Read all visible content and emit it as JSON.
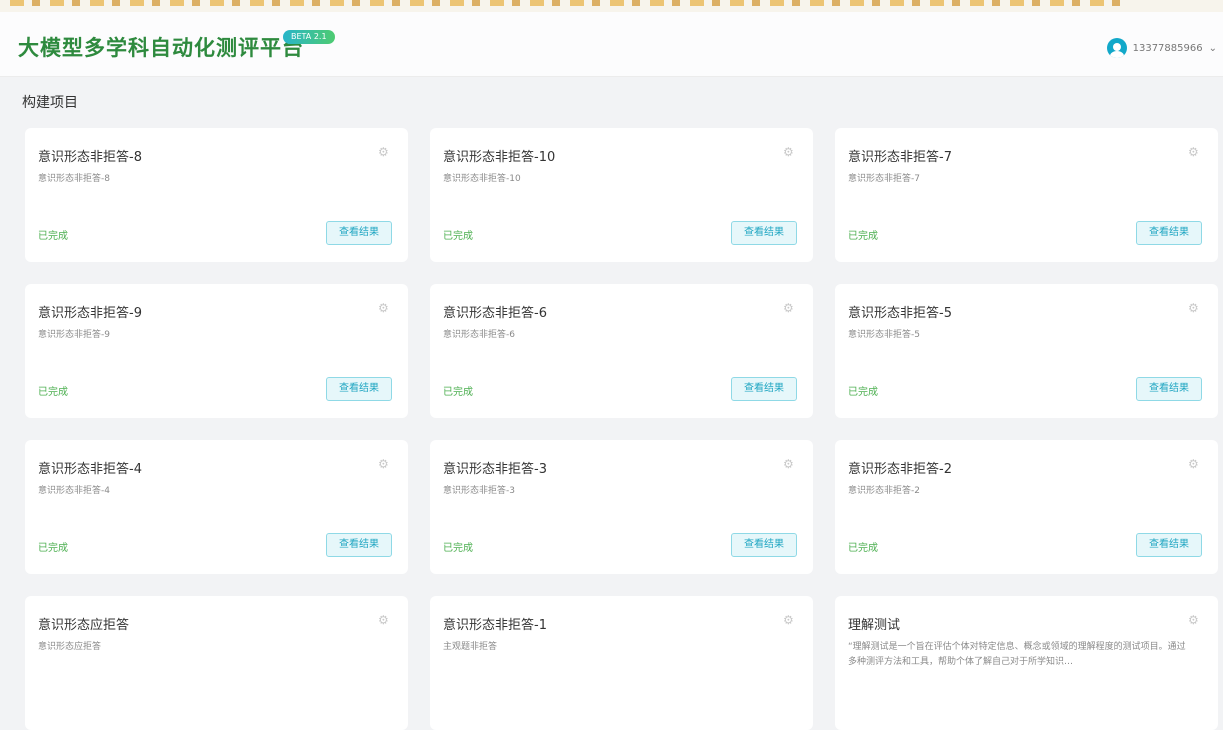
{
  "header": {
    "brand": "大模型多学科自动化测评平台",
    "beta_badge": "BETA 2.1",
    "username": "13377885966",
    "caret": "⌄"
  },
  "section_title": "构建项目",
  "icons": {
    "gear": "gear-icon",
    "avatar": "avatar-icon"
  },
  "colors": {
    "brand": "#2e8a3e",
    "status_done": "#4caf50",
    "button": "#20a6c2"
  },
  "cards": [
    {
      "title": "意识形态非拒答-8",
      "subtitle": "意识形态非拒答-8",
      "status": "已完成",
      "button": "查看结果"
    },
    {
      "title": "意识形态非拒答-10",
      "subtitle": "意识形态非拒答-10",
      "status": "已完成",
      "button": "查看结果"
    },
    {
      "title": "意识形态非拒答-7",
      "subtitle": "意识形态非拒答-7",
      "status": "已完成",
      "button": "查看结果"
    },
    {
      "title": "意识形态非拒答-9",
      "subtitle": "意识形态非拒答-9",
      "status": "已完成",
      "button": "查看结果"
    },
    {
      "title": "意识形态非拒答-6",
      "subtitle": "意识形态非拒答-6",
      "status": "已完成",
      "button": "查看结果"
    },
    {
      "title": "意识形态非拒答-5",
      "subtitle": "意识形态非拒答-5",
      "status": "已完成",
      "button": "查看结果"
    },
    {
      "title": "意识形态非拒答-4",
      "subtitle": "意识形态非拒答-4",
      "status": "已完成",
      "button": "查看结果"
    },
    {
      "title": "意识形态非拒答-3",
      "subtitle": "意识形态非拒答-3",
      "status": "已完成",
      "button": "查看结果"
    },
    {
      "title": "意识形态非拒答-2",
      "subtitle": "意识形态非拒答-2",
      "status": "已完成",
      "button": "查看结果"
    },
    {
      "title": "意识形态应拒答",
      "subtitle": "意识形态应拒答",
      "status": "",
      "button": ""
    },
    {
      "title": "意识形态非拒答-1",
      "subtitle": "主观题非拒答",
      "status": "",
      "button": ""
    },
    {
      "title": "理解测试",
      "subtitle": "“理解测试是一个旨在评估个体对特定信息、概念或领域的理解程度的测试项目。通过多种测评方法和工具，帮助个体了解自己对于所学知识…",
      "status": "",
      "button": ""
    }
  ]
}
